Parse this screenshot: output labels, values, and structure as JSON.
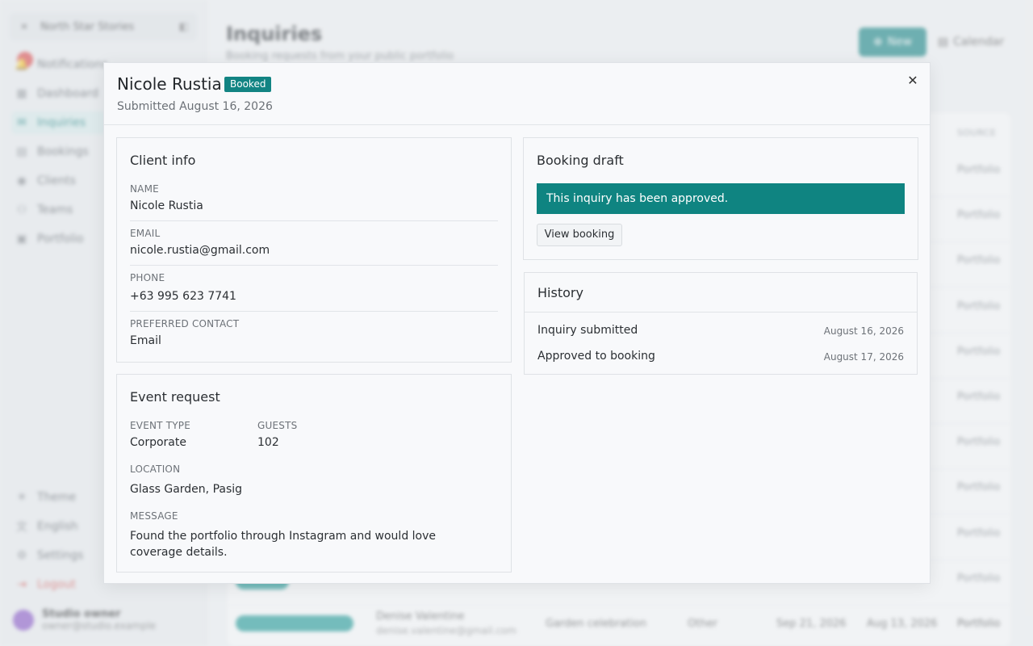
{
  "background": {
    "sidebar": {
      "org_name": "North Star Stories",
      "items": [
        {
          "label": "Notifications",
          "icon": "bell-icon"
        },
        {
          "label": "Dashboard",
          "icon": "dashboard-icon"
        },
        {
          "label": "Inquiries",
          "icon": "inbox-icon"
        },
        {
          "label": "Bookings",
          "icon": "calendar-icon"
        },
        {
          "label": "Clients",
          "icon": "users-icon"
        },
        {
          "label": "Teams",
          "icon": "team-icon"
        },
        {
          "label": "Portfolio",
          "icon": "image-icon"
        }
      ],
      "bottom_items": [
        {
          "label": "Theme",
          "icon": "sun-icon"
        },
        {
          "label": "English",
          "icon": "language-icon"
        },
        {
          "label": "Settings",
          "icon": "gear-icon"
        },
        {
          "label": "Logout",
          "icon": "logout-icon"
        }
      ],
      "user": {
        "name": "Studio owner",
        "email": "owner@studio.example"
      }
    },
    "main": {
      "title": "Inquiries",
      "subtitle": "Booking requests from your public portfolio",
      "new_button": "New",
      "calendar_button": "Calendar",
      "source_header": "SOURCE",
      "source_values": [
        "Portfolio",
        "Portfolio",
        "Portfolio",
        "Portfolio",
        "Portfolio",
        "Portfolio",
        "Portfolio",
        "Portfolio",
        "Portfolio",
        "Portfolio",
        "Portfolio"
      ],
      "last_row": {
        "name": "Denise Valentine",
        "email": "denise.valentine@gmail.com",
        "event": "Garden celebration",
        "type": "Other",
        "date1": "Sep 21, 2026",
        "date2": "Aug 13, 2026",
        "source": "Portfolio"
      }
    }
  },
  "modal": {
    "title": "Nicole Rustia",
    "status": "Booked",
    "submitted": "Submitted August 16, 2026",
    "close_icon": "close-icon",
    "client_info": {
      "title": "Client info",
      "fields": [
        {
          "label": "NAME",
          "value": "Nicole Rustia"
        },
        {
          "label": "EMAIL",
          "value": "nicole.rustia@gmail.com"
        },
        {
          "label": "PHONE",
          "value": "+63 995 623 7741"
        },
        {
          "label": "PREFERRED CONTACT",
          "value": "Email"
        }
      ]
    },
    "event_request": {
      "title": "Event request",
      "event_type_label": "EVENT TYPE",
      "event_type": "Corporate",
      "guests_label": "GUESTS",
      "guests": "102",
      "location_label": "LOCATION",
      "location": "Glass Garden, Pasig",
      "message_label": "MESSAGE",
      "message": "Found the portfolio through Instagram and would love coverage details."
    },
    "booking_draft": {
      "title": "Booking draft",
      "banner": "This inquiry has been approved.",
      "view_button": "View booking"
    },
    "history": {
      "title": "History",
      "entries": [
        {
          "label": "Inquiry submitted",
          "date": "August 16, 2026"
        },
        {
          "label": "Approved to booking",
          "date": "August 17, 2026"
        }
      ]
    }
  },
  "colors": {
    "accent": "#128483",
    "logout": "#d9534f",
    "notification": "#e04848"
  }
}
